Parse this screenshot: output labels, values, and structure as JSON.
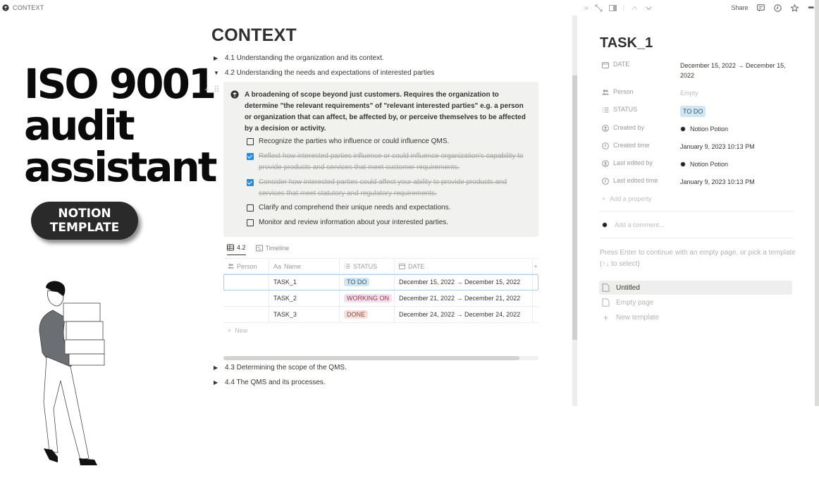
{
  "breadcrumb": {
    "icon": "cube-icon",
    "label": "CONTEXT"
  },
  "promo": {
    "title_lines": [
      "ISO 9001",
      "audit",
      "assistant"
    ],
    "badge_lines": [
      "NOTION",
      "TEMPLATE"
    ],
    "illustration": "person-carrying-boxes"
  },
  "page": {
    "title": "CONTEXT",
    "toggles_top": [
      {
        "label": "4.1 Understanding the organization and its context.",
        "expanded": false
      },
      {
        "label": "4.2 Understanding the needs and expectations of interested parties",
        "expanded": true
      }
    ],
    "callout": {
      "icon": "cube-icon",
      "text": "A broadening of scope beyond just customers. Requires the organization to determine \"the relevant requirements\" of \"relevant interested parties\" e.g. a person or organization that can affect, be affected by, or perceive themselves to be affected by a decision or activity.",
      "todos": [
        {
          "text": "Recognize the parties who influence or could influence QMS.",
          "checked": false
        },
        {
          "text": "Reflect how interested parties influence or could influence organization's capability to provide products and services that meet customer requirements.",
          "checked": true
        },
        {
          "text": "Consider how interested parties could affect your ability to provide products and services that meet statutory and regulatory requirements.",
          "checked": true
        },
        {
          "text": "Clarify and comprehend their unique needs and expectations.",
          "checked": false
        },
        {
          "text": "Monitor and review information about your interested parties.",
          "checked": false
        }
      ]
    },
    "database": {
      "views": [
        {
          "label": "4.2",
          "icon": "table-icon",
          "active": true
        },
        {
          "label": "Timeline",
          "icon": "timeline-icon",
          "active": false
        }
      ],
      "columns": [
        {
          "label": "Person",
          "icon": "people-icon"
        },
        {
          "label": "Name",
          "icon": "text-icon",
          "icon_text": "Aa"
        },
        {
          "label": "STATUS",
          "icon": "list-icon"
        },
        {
          "label": "DATE",
          "icon": "calendar-icon"
        }
      ],
      "add_column": "+",
      "rows": [
        {
          "person": "",
          "name": "TASK_1",
          "status": "TO DO",
          "status_bg": "#d3e5ef",
          "status_fg": "#2b5b7a",
          "date": "December 15, 2022 → December 15, 2022",
          "selected": true
        },
        {
          "person": "",
          "name": "TASK_2",
          "status": "WORKING ON",
          "status_bg": "#f5e0e9",
          "status_fg": "#8a3a5e",
          "date": "December 21, 2022 → December 21, 2022",
          "selected": false
        },
        {
          "person": "",
          "name": "TASK_3",
          "status": "DONE",
          "status_bg": "#f5e0dd",
          "status_fg": "#8a4b40",
          "date": "December 24, 2022 → December 24, 2022",
          "selected": false
        }
      ],
      "new_label": "New"
    },
    "toggles_bottom": [
      {
        "label": "4.3 Determining the scope of the QMS.",
        "expanded": false
      },
      {
        "label": "4.4 The QMS and its processes.",
        "expanded": false
      }
    ]
  },
  "peek": {
    "toolbar": {
      "share": "Share",
      "icons_left": [
        "collapse-icon",
        "expand-icon",
        "sidepeek-icon",
        "up-icon",
        "down-icon"
      ],
      "icons_right": [
        "comment-icon",
        "history-icon",
        "star-icon",
        "more-icon"
      ]
    },
    "title": "TASK_1",
    "properties": [
      {
        "key": "DATE",
        "icon": "calendar-icon",
        "value": "December 15, 2022 → December 15, 2022"
      },
      {
        "key": "Person",
        "icon": "people-icon",
        "value": "Empty",
        "empty": true
      },
      {
        "key": "STATUS",
        "icon": "list-icon",
        "value": "TO DO",
        "tag": true
      },
      {
        "key": "Created by",
        "icon": "user-circle-icon",
        "value": "Notion Potion",
        "avatar": true
      },
      {
        "key": "Created time",
        "icon": "clock-icon",
        "value": "January 9, 2023 10:13 PM"
      },
      {
        "key": "Last edited by",
        "icon": "user-circle-icon",
        "value": "Notion Potion",
        "avatar": true
      },
      {
        "key": "Last edited time",
        "icon": "clock-icon",
        "value": "January 9, 2023 10:13 PM"
      }
    ],
    "add_property": "Add a property",
    "comment_placeholder": "Add a comment...",
    "hint": "Press Enter to continue with an empty page, or pick a template (↑↓ to select)",
    "templates": [
      {
        "label": "Untitled",
        "icon": "page-icon",
        "active": true
      },
      {
        "label": "Empty page",
        "icon": "page-icon",
        "active": false
      },
      {
        "label": "New template",
        "icon": "plus-icon",
        "active": false
      }
    ]
  }
}
